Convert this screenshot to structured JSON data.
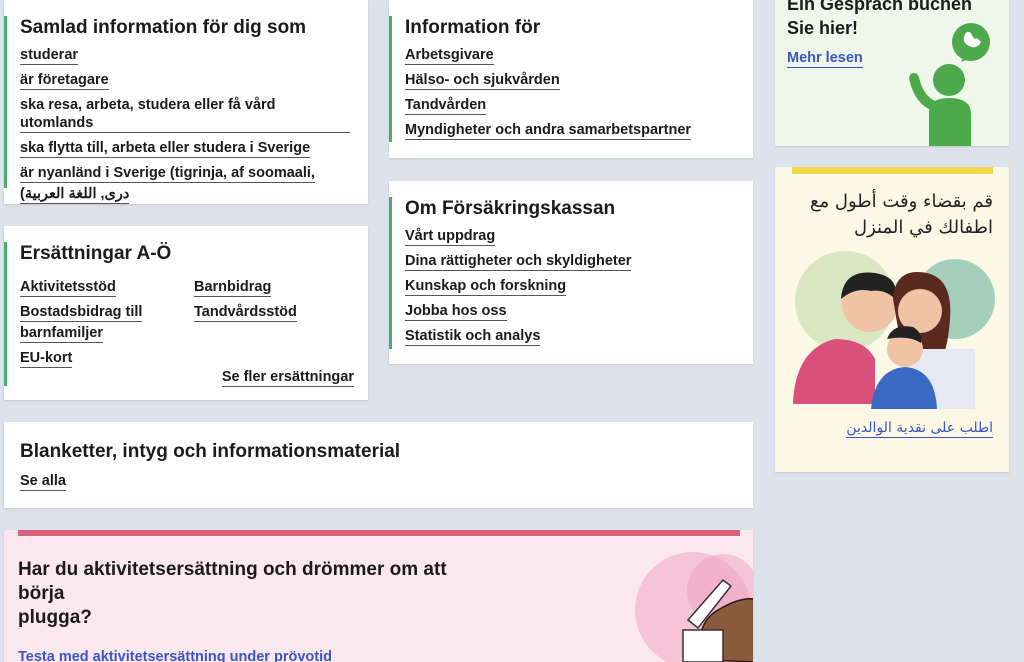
{
  "samlad": {
    "title": "Samlad information för dig som",
    "links": [
      "studerar",
      "är företagare",
      "ska resa, arbeta, studera eller få vård utomlands",
      "ska flytta till, arbeta eller studera i Sverige",
      "är nyanländ i Sverige (tigrinja, af soomaali,",
      "دری, اللغة العربية)"
    ]
  },
  "info": {
    "title": "Information för",
    "links": [
      "Arbetsgivare",
      "Hälso- och sjukvården",
      "Tandvården",
      "Myndigheter och andra samarbetspartner"
    ]
  },
  "om": {
    "title": "Om Försäkringskassan",
    "links": [
      "Vårt uppdrag",
      "Dina rättigheter och skyldigheter",
      "Kunskap och forskning",
      "Jobba hos oss",
      "Statistik och analys"
    ]
  },
  "ersattningar": {
    "title": "Ersättningar A-Ö",
    "left": [
      "Aktivitetsstöd",
      "Bostadsbidrag till",
      "barnfamiljer",
      "EU-kort"
    ],
    "right": [
      "Barnbidrag",
      "Tandvårdsstöd"
    ],
    "more": "Se fler ersättningar"
  },
  "blanketter": {
    "title": "Blanketter, intyg och informationsmaterial",
    "link": "Se alla"
  },
  "promo": {
    "title_line1": "Har du aktivitetsersättning och drömmer om att börja",
    "title_line2": "plugga?",
    "link": "Testa med aktivitetsersättning under prövotid",
    "bar_color": "#d9637f"
  },
  "ad_german": {
    "line1": "Ein Gespräch buchen",
    "line2": "Sie hier!",
    "link": "Mehr lesen",
    "icon": "phone-bubble-icon"
  },
  "ad_arabic": {
    "line1": "قم بقضاء وقت أطول مع",
    "line2": "اطفالك في المنزل",
    "link": "اطلب على نقدية الوالدين",
    "bar_color": "#f2d64b"
  }
}
